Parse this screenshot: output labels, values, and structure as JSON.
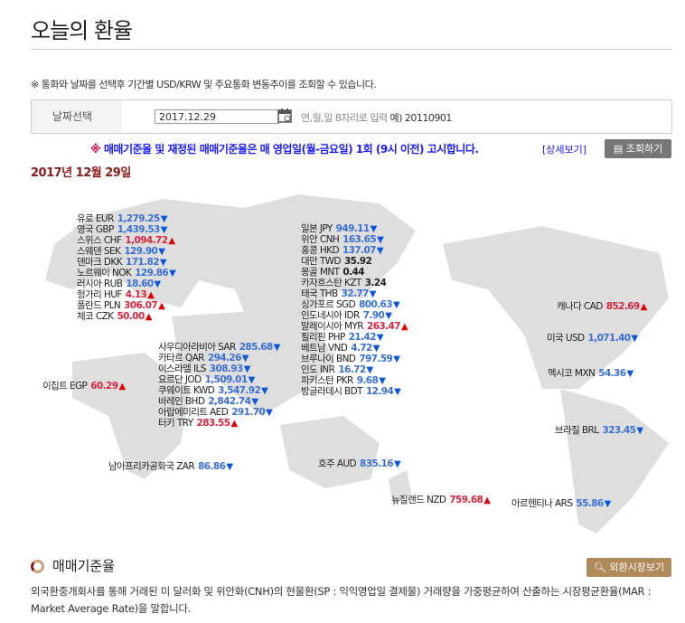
{
  "title": "오늘의 환율",
  "notice": "※ 통화와 날짜를 선택후 기간별 USD/KRW 및 주요통화 변동추이를 조회할 수 있습니다.",
  "date_search": {
    "label": "날짜선택",
    "value": "2017.12.29",
    "hint": "연,월,일 8자리로 입력",
    "example": "예) 20110901"
  },
  "announce": {
    "mark": "※",
    "text": "매매기준율 및 재정된 매매기준율은 매 영업일(월-금요일) 1회 (9시 이전) 고시합니다.",
    "detail_link": "[상세보기]",
    "lookup_button": "조회하기"
  },
  "current_date": "2017년 12월 29일",
  "rates": [
    {
      "name": "유로 EUR",
      "value": "1,279.25",
      "dir": "down"
    },
    {
      "name": "영국 GBP",
      "value": "1,439.53",
      "dir": "down"
    },
    {
      "name": "스위스 CHF",
      "value": "1,094.72",
      "dir": "up"
    },
    {
      "name": "스웨덴 SEK",
      "value": "129.90",
      "dir": "down"
    },
    {
      "name": "덴마크 DKK",
      "value": "171.82",
      "dir": "down"
    },
    {
      "name": "노르웨이 NOK",
      "value": "129.86",
      "dir": "down"
    },
    {
      "name": "러시아 RUB",
      "value": "18.60",
      "dir": "down"
    },
    {
      "name": "헝가리 HUF",
      "value": "4.13",
      "dir": "up"
    },
    {
      "name": "폴란드 PLN",
      "value": "306.07",
      "dir": "up"
    },
    {
      "name": "체코 CZK",
      "value": "50.00",
      "dir": "up"
    },
    {
      "name": "일본 JPY",
      "value": "949.11",
      "dir": "down"
    },
    {
      "name": "위안 CNH",
      "value": "163.65",
      "dir": "down"
    },
    {
      "name": "홍콩 HKD",
      "value": "137.07",
      "dir": "down"
    },
    {
      "name": "대만 TWD",
      "value": "35.92",
      "dir": "flat"
    },
    {
      "name": "몽골 MNT",
      "value": "0.44",
      "dir": "flat"
    },
    {
      "name": "카자흐스탄 KZT",
      "value": "3.24",
      "dir": "flat"
    },
    {
      "name": "태국 THB",
      "value": "32.77",
      "dir": "down"
    },
    {
      "name": "싱가포르 SGD",
      "value": "800.63",
      "dir": "down"
    },
    {
      "name": "인도네시아 IDR",
      "value": "7.90",
      "dir": "down"
    },
    {
      "name": "말레이시아 MYR",
      "value": "263.47",
      "dir": "up"
    },
    {
      "name": "필리핀 PHP",
      "value": "21.42",
      "dir": "down"
    },
    {
      "name": "베트남 VND",
      "value": "4.72",
      "dir": "down"
    },
    {
      "name": "브루나이 BND",
      "value": "797.59",
      "dir": "down"
    },
    {
      "name": "인도 INR",
      "value": "16.72",
      "dir": "down"
    },
    {
      "name": "파키스탄 PKR",
      "value": "9.68",
      "dir": "down"
    },
    {
      "name": "방글라데시 BDT",
      "value": "12.94",
      "dir": "down"
    },
    {
      "name": "사우디아라비아 SAR",
      "value": "285.68",
      "dir": "down"
    },
    {
      "name": "카타르 QAR",
      "value": "294.26",
      "dir": "down"
    },
    {
      "name": "이스라엘 ILS",
      "value": "308.93",
      "dir": "down"
    },
    {
      "name": "요르단 JOD",
      "value": "1,509.01",
      "dir": "down"
    },
    {
      "name": "쿠웨이트 KWD",
      "value": "3,547.92",
      "dir": "down"
    },
    {
      "name": "바레인 BHD",
      "value": "2,842.74",
      "dir": "down"
    },
    {
      "name": "아랍에미리트 AED",
      "value": "291.70",
      "dir": "down"
    },
    {
      "name": "터키 TRY",
      "value": "283.55",
      "dir": "up"
    },
    {
      "name": "이집트 EGP",
      "value": "60.29",
      "dir": "up"
    },
    {
      "name": "남아프리카공화국 ZAR",
      "value": "86.86",
      "dir": "down"
    },
    {
      "name": "호주 AUD",
      "value": "835.16",
      "dir": "down"
    },
    {
      "name": "뉴질랜드 NZD",
      "value": "759.68",
      "dir": "up"
    },
    {
      "name": "아르헨티나 ARS",
      "value": "55.86",
      "dir": "down"
    },
    {
      "name": "브라질 BRL",
      "value": "323.45",
      "dir": "down"
    },
    {
      "name": "멕시코 MXN",
      "value": "54.36",
      "dir": "down"
    },
    {
      "name": "미국 USD",
      "value": "1,071.40",
      "dir": "down"
    },
    {
      "name": "캐나다 CAD",
      "value": "852.69",
      "dir": "up"
    }
  ],
  "section": {
    "title": "매매기준율",
    "button": "외환시장보기",
    "description": "외국환중개회사를 통해 거래된 미 달러화 및 위안화(CNH)의 현물환(SP : 익익영업일 결제물) 거래량을 가중평균하여 산출하는 시장평균환율(MAR : Market Average Rate)을 말합니다."
  },
  "colors": {
    "up": "#d7263d",
    "down": "#3a6fd8",
    "accent": "#8b1b1b"
  }
}
